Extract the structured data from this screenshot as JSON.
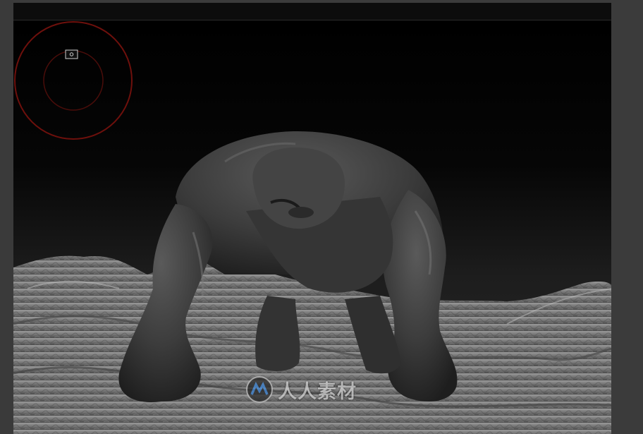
{
  "watermark": {
    "text": "人人素材",
    "icon": "rr-logo-icon"
  },
  "colors": {
    "brush_ring": "#7a0f0b",
    "top_bar": "#0c0c0c",
    "chrome": "#3a3a3a"
  }
}
